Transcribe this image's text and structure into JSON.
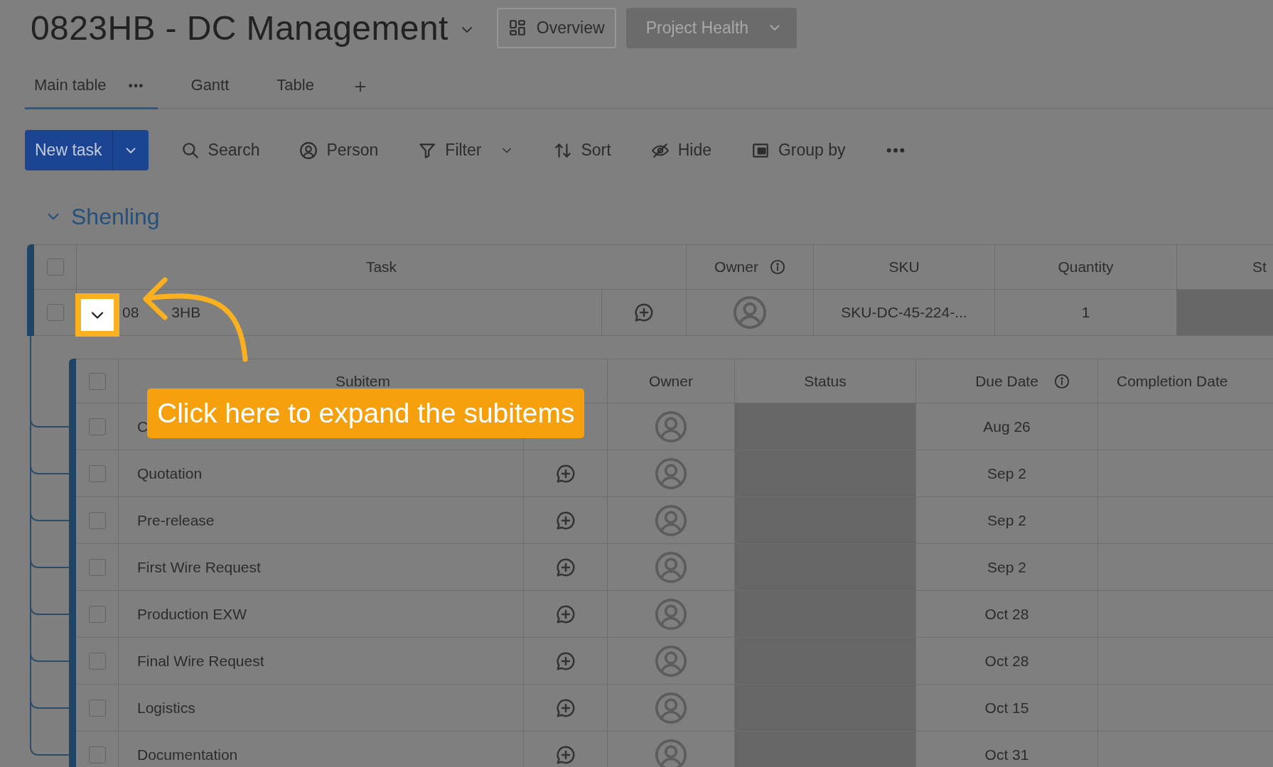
{
  "board": {
    "title": "0823HB - DC Management",
    "views": [
      {
        "label": "Overview",
        "disabled": false
      },
      {
        "label": "Project Health",
        "disabled": true
      }
    ]
  },
  "tabs": [
    {
      "label": "Main table",
      "selected": true
    },
    {
      "label": "Gantt",
      "selected": false
    },
    {
      "label": "Table",
      "selected": false
    }
  ],
  "toolbar": {
    "new_task": "New task",
    "items": [
      {
        "kind": "search",
        "label": "Search"
      },
      {
        "kind": "person",
        "label": "Person"
      },
      {
        "kind": "filter",
        "label": "Filter"
      },
      {
        "kind": "sort",
        "label": "Sort"
      },
      {
        "kind": "hide",
        "label": "Hide"
      },
      {
        "kind": "group",
        "label": "Group by"
      }
    ]
  },
  "group": {
    "name": "Shenling",
    "expanded": true,
    "all_checked": false,
    "columns": [
      "Task",
      "Owner",
      "SKU",
      "Quantity",
      "St"
    ],
    "rows": [
      {
        "name": "08",
        "name_tail": "3HB",
        "checked": false,
        "sku": "SKU-DC-45-224-...",
        "quantity": "1"
      }
    ]
  },
  "subitems": {
    "all_checked": false,
    "columns": [
      "Subitem",
      "Owner",
      "Status",
      "Due Date",
      "Completion Date"
    ],
    "rows": [
      {
        "name": "C",
        "checked": false,
        "due": "Aug 26"
      },
      {
        "name": "Quotation",
        "checked": false,
        "due": "Sep 2"
      },
      {
        "name": "Pre-release",
        "checked": false,
        "due": "Sep 2"
      },
      {
        "name": "First Wire Request",
        "checked": false,
        "due": "Sep 2"
      },
      {
        "name": "Production EXW",
        "checked": false,
        "due": "Oct 28"
      },
      {
        "name": "Final Wire Request",
        "checked": false,
        "due": "Oct 28"
      },
      {
        "name": "Logistics",
        "checked": false,
        "due": "Oct 15"
      },
      {
        "name": "Documentation",
        "checked": false,
        "due": "Oct 31"
      }
    ]
  },
  "callout": {
    "text": "Click here to expand the subitems"
  }
}
